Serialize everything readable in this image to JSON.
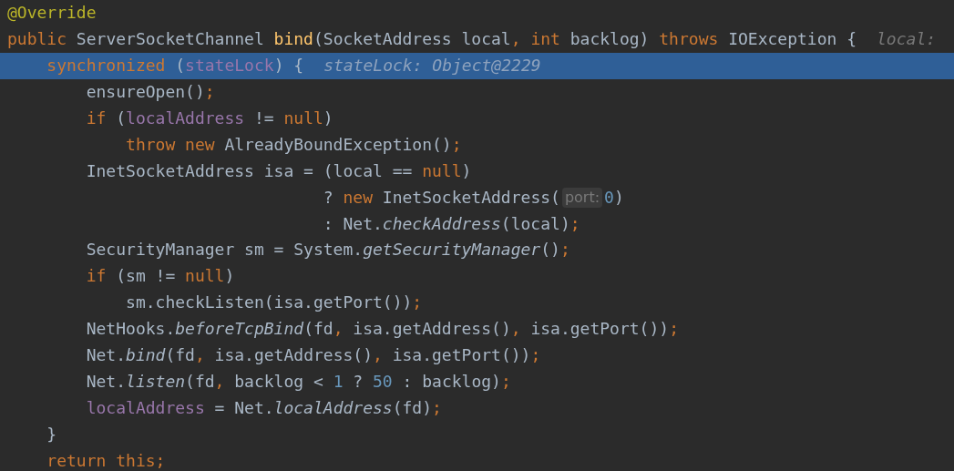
{
  "editor": {
    "lines": [
      {
        "highlighted": false,
        "parts": [
          {
            "kind": "code",
            "tokens": [
              {
                "kind": "annotation",
                "text": "@Override"
              }
            ]
          }
        ]
      },
      {
        "highlighted": false,
        "parts": [
          {
            "kind": "code",
            "tokens": [
              {
                "kind": "keyword",
                "text": "public"
              },
              {
                "kind": "plain",
                "text": " ServerSocketChannel "
              },
              {
                "kind": "declaration",
                "text": "bind"
              },
              {
                "kind": "plain",
                "text": "(SocketAddress local"
              },
              {
                "kind": "keyword",
                "text": ", int"
              },
              {
                "kind": "plain",
                "text": " backlog) "
              },
              {
                "kind": "keyword",
                "text": "throws"
              },
              {
                "kind": "plain",
                "text": " IOException {"
              }
            ]
          },
          {
            "kind": "value-hint",
            "text": "local:"
          }
        ]
      },
      {
        "highlighted": true,
        "parts": [
          {
            "kind": "code",
            "tokens": [
              {
                "kind": "keyword",
                "text": "    synchronized"
              },
              {
                "kind": "plain",
                "text": " ("
              },
              {
                "kind": "field",
                "text": "stateLock"
              },
              {
                "kind": "plain",
                "text": ") {"
              }
            ]
          },
          {
            "kind": "value-hint",
            "text": "stateLock: Object@2229"
          }
        ]
      },
      {
        "highlighted": false,
        "parts": [
          {
            "kind": "code",
            "tokens": [
              {
                "kind": "plain",
                "text": "        ensureOpen()"
              },
              {
                "kind": "keyword",
                "text": ";"
              }
            ]
          }
        ]
      },
      {
        "highlighted": false,
        "parts": [
          {
            "kind": "code",
            "tokens": [
              {
                "kind": "keyword",
                "text": "        if"
              },
              {
                "kind": "plain",
                "text": " ("
              },
              {
                "kind": "field",
                "text": "localAddress"
              },
              {
                "kind": "plain",
                "text": " != "
              },
              {
                "kind": "keyword",
                "text": "null"
              },
              {
                "kind": "plain",
                "text": ")"
              }
            ]
          }
        ]
      },
      {
        "highlighted": false,
        "parts": [
          {
            "kind": "code",
            "tokens": [
              {
                "kind": "keyword",
                "text": "            throw new"
              },
              {
                "kind": "plain",
                "text": " AlreadyBoundException()"
              },
              {
                "kind": "keyword",
                "text": ";"
              }
            ]
          }
        ]
      },
      {
        "highlighted": false,
        "parts": [
          {
            "kind": "code",
            "tokens": [
              {
                "kind": "plain",
                "text": "        InetSocketAddress isa = (local == "
              },
              {
                "kind": "keyword",
                "text": "null"
              },
              {
                "kind": "plain",
                "text": ")"
              }
            ]
          }
        ]
      },
      {
        "highlighted": false,
        "parts": [
          {
            "kind": "code",
            "tokens": [
              {
                "kind": "plain",
                "text": "                                ? "
              },
              {
                "kind": "keyword",
                "text": "new"
              },
              {
                "kind": "plain",
                "text": " InetSocketAddress("
              }
            ]
          },
          {
            "kind": "param-hint",
            "text": "port:"
          },
          {
            "kind": "code",
            "tokens": [
              {
                "kind": "number",
                "text": "0"
              },
              {
                "kind": "plain",
                "text": ")"
              }
            ]
          }
        ]
      },
      {
        "highlighted": false,
        "parts": [
          {
            "kind": "code",
            "tokens": [
              {
                "kind": "plain",
                "text": "                                : Net."
              },
              {
                "kind": "static",
                "text": "checkAddress"
              },
              {
                "kind": "plain",
                "text": "(local)"
              },
              {
                "kind": "keyword",
                "text": ";"
              }
            ]
          }
        ]
      },
      {
        "highlighted": false,
        "parts": [
          {
            "kind": "code",
            "tokens": [
              {
                "kind": "plain",
                "text": "        SecurityManager sm = System."
              },
              {
                "kind": "static",
                "text": "getSecurityManager"
              },
              {
                "kind": "plain",
                "text": "()"
              },
              {
                "kind": "keyword",
                "text": ";"
              }
            ]
          }
        ]
      },
      {
        "highlighted": false,
        "parts": [
          {
            "kind": "code",
            "tokens": [
              {
                "kind": "keyword",
                "text": "        if"
              },
              {
                "kind": "plain",
                "text": " (sm != "
              },
              {
                "kind": "keyword",
                "text": "null"
              },
              {
                "kind": "plain",
                "text": ")"
              }
            ]
          }
        ]
      },
      {
        "highlighted": false,
        "parts": [
          {
            "kind": "code",
            "tokens": [
              {
                "kind": "plain",
                "text": "            sm.checkListen(isa.getPort())"
              },
              {
                "kind": "keyword",
                "text": ";"
              }
            ]
          }
        ]
      },
      {
        "highlighted": false,
        "parts": [
          {
            "kind": "code",
            "tokens": [
              {
                "kind": "plain",
                "text": "        NetHooks."
              },
              {
                "kind": "static",
                "text": "beforeTcpBind"
              },
              {
                "kind": "plain",
                "text": "(fd"
              },
              {
                "kind": "keyword",
                "text": ","
              },
              {
                "kind": "plain",
                "text": " isa.getAddress()"
              },
              {
                "kind": "keyword",
                "text": ","
              },
              {
                "kind": "plain",
                "text": " isa.getPort())"
              },
              {
                "kind": "keyword",
                "text": ";"
              }
            ]
          }
        ]
      },
      {
        "highlighted": false,
        "parts": [
          {
            "kind": "code",
            "tokens": [
              {
                "kind": "plain",
                "text": "        Net."
              },
              {
                "kind": "static",
                "text": "bind"
              },
              {
                "kind": "plain",
                "text": "(fd"
              },
              {
                "kind": "keyword",
                "text": ","
              },
              {
                "kind": "plain",
                "text": " isa.getAddress()"
              },
              {
                "kind": "keyword",
                "text": ","
              },
              {
                "kind": "plain",
                "text": " isa.getPort())"
              },
              {
                "kind": "keyword",
                "text": ";"
              }
            ]
          }
        ]
      },
      {
        "highlighted": false,
        "parts": [
          {
            "kind": "code",
            "tokens": [
              {
                "kind": "plain",
                "text": "        Net."
              },
              {
                "kind": "static",
                "text": "listen"
              },
              {
                "kind": "plain",
                "text": "(fd"
              },
              {
                "kind": "keyword",
                "text": ","
              },
              {
                "kind": "plain",
                "text": " backlog < "
              },
              {
                "kind": "number",
                "text": "1"
              },
              {
                "kind": "plain",
                "text": " ? "
              },
              {
                "kind": "number",
                "text": "50"
              },
              {
                "kind": "plain",
                "text": " : backlog)"
              },
              {
                "kind": "keyword",
                "text": ";"
              }
            ]
          }
        ]
      },
      {
        "highlighted": false,
        "parts": [
          {
            "kind": "code",
            "tokens": [
              {
                "kind": "field",
                "text": "        localAddress"
              },
              {
                "kind": "plain",
                "text": " = Net."
              },
              {
                "kind": "static",
                "text": "localAddress"
              },
              {
                "kind": "plain",
                "text": "(fd)"
              },
              {
                "kind": "keyword",
                "text": ";"
              }
            ]
          }
        ]
      },
      {
        "highlighted": false,
        "parts": [
          {
            "kind": "code",
            "tokens": [
              {
                "kind": "plain",
                "text": "    }"
              }
            ]
          }
        ]
      },
      {
        "highlighted": false,
        "parts": [
          {
            "kind": "code",
            "tokens": [
              {
                "kind": "keyword",
                "text": "    return this;"
              }
            ]
          }
        ]
      }
    ]
  }
}
